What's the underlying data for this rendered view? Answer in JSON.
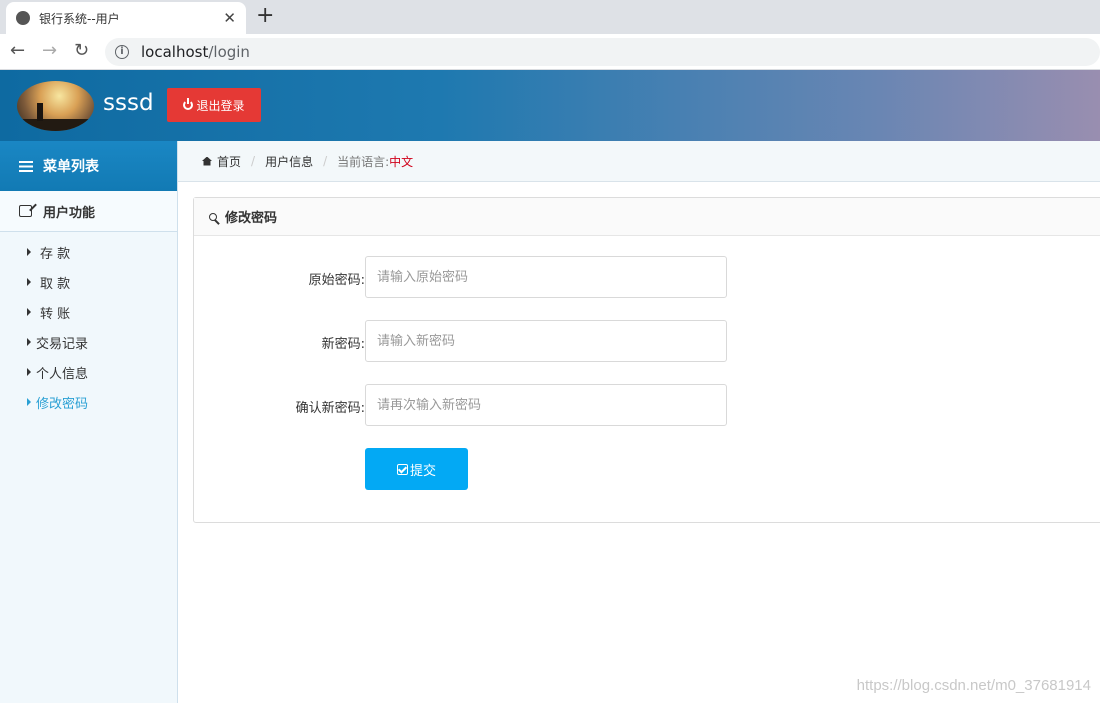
{
  "browser": {
    "tab_title": "银行系统--用户",
    "url_host": "localhost",
    "url_path": "/login",
    "close_glyph": "✕",
    "new_tab_glyph": "+",
    "back_glyph": "←",
    "forward_glyph": "→",
    "reload_glyph": "↻",
    "info_glyph": "i"
  },
  "header": {
    "username": "sssd",
    "logout_label": "退出登录",
    "colors": {
      "bg_start": "#0e6aa1",
      "bg_end": "#998eb0",
      "logout_bg": "#e53935"
    }
  },
  "sidebar": {
    "title": "菜单列表",
    "group_label": "用户功能",
    "items": [
      {
        "label": "存 款",
        "active": false
      },
      {
        "label": "取 款",
        "active": false
      },
      {
        "label": "转 账",
        "active": false
      },
      {
        "label": "交易记录",
        "active": false
      },
      {
        "label": "个人信息",
        "active": false
      },
      {
        "label": "修改密码",
        "active": true
      }
    ],
    "colors": {
      "active": "#2aa0d4"
    }
  },
  "breadcrumb": {
    "home": "首页",
    "current": "用户信息",
    "lang_label": "当前语言:",
    "lang_value": "中文"
  },
  "panel": {
    "title": "修改密码",
    "fields": [
      {
        "label": "原始密码:",
        "placeholder": "请输入原始密码",
        "value": ""
      },
      {
        "label": "新密码:",
        "placeholder": "请输入新密码",
        "value": ""
      },
      {
        "label": "确认新密码:",
        "placeholder": "请再次输入新密码",
        "value": ""
      }
    ],
    "submit_label": "提交",
    "colors": {
      "submit_bg": "#03a9f4"
    }
  },
  "watermark": "https://blog.csdn.net/m0_37681914"
}
